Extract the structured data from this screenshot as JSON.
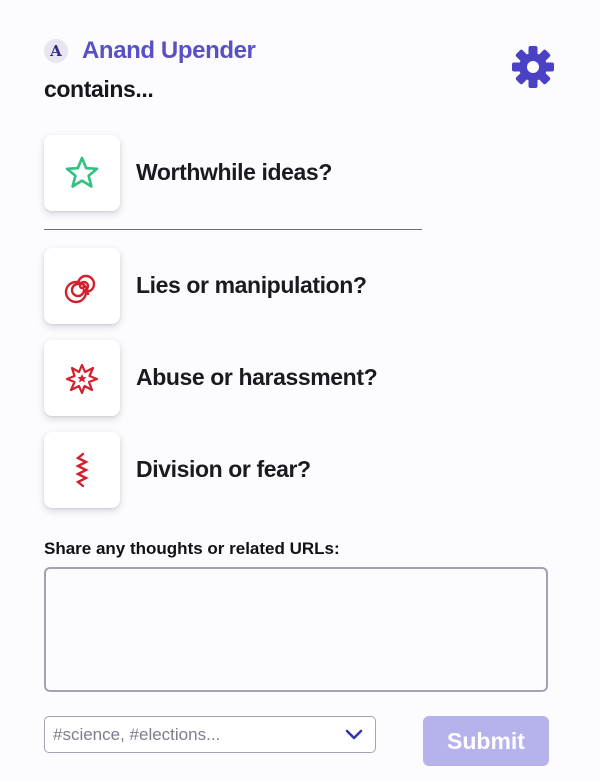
{
  "header": {
    "avatar_letter": "A",
    "author_name": "Anand Upender",
    "subtitle": "contains...",
    "settings_icon": "gear-icon"
  },
  "options": [
    {
      "label": "Worthwhile ideas?",
      "icon": "star-icon",
      "color": "#2ec27e"
    },
    {
      "label": "Lies or manipulation?",
      "icon": "spiral-icon",
      "color": "#d31f2e"
    },
    {
      "label": "Abuse or harassment?",
      "icon": "burst-icon",
      "color": "#d31f2e"
    },
    {
      "label": "Division or fear?",
      "icon": "zigzag-icon",
      "color": "#d31f2e"
    }
  ],
  "comment": {
    "label": "Share any thoughts or related URLs:",
    "value": ""
  },
  "tags": {
    "placeholder": "#science, #elections..."
  },
  "submit": {
    "label": "Submit"
  },
  "colors": {
    "accent": "#5a50c6",
    "submit_disabled": "#b5b2ec",
    "positive": "#2ec27e",
    "negative": "#d31f2e"
  }
}
